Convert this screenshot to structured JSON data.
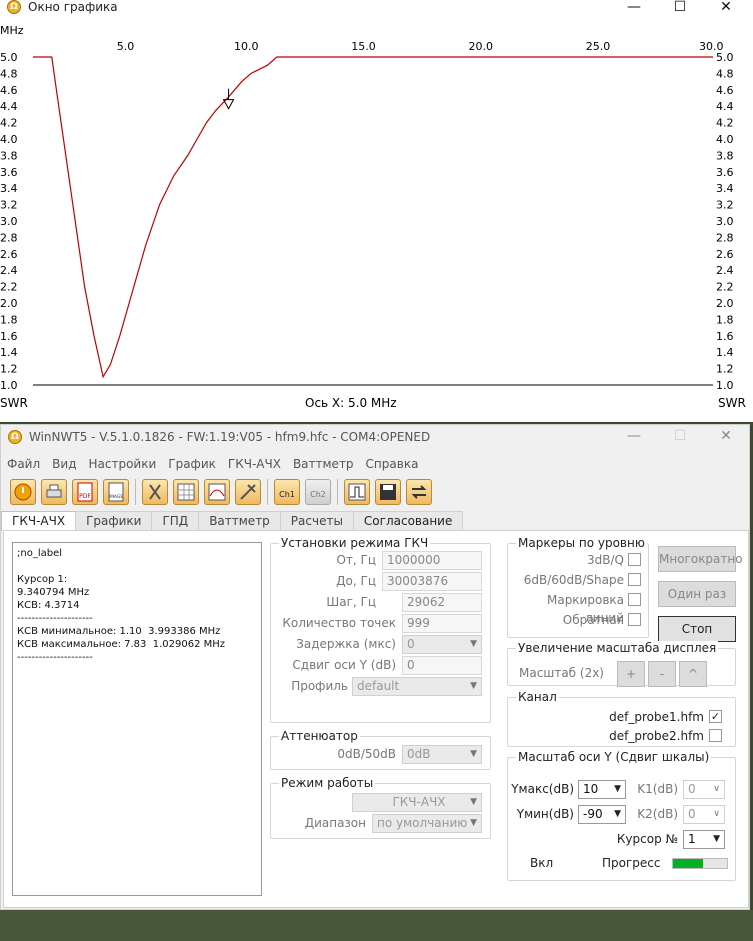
{
  "graph_window": {
    "title": "Окно графика",
    "chart_data": {
      "type": "line",
      "x_unit": "MHz",
      "y_unit_left": "SWR",
      "y_unit_right": "SWR",
      "x_ticks": [
        "5.0",
        "10.0",
        "15.0",
        "20.0",
        "25.0",
        "30.0"
      ],
      "y_ticks": [
        "5.0",
        "4.8",
        "4.6",
        "4.4",
        "4.2",
        "4.0",
        "3.8",
        "3.6",
        "3.4",
        "3.2",
        "3.0",
        "2.8",
        "2.6",
        "2.4",
        "2.2",
        "2.0",
        "1.8",
        "1.6",
        "1.4",
        "1.2",
        "1.0"
      ],
      "xlim": [
        1.0,
        30.0
      ],
      "ylim": [
        1.0,
        5.0
      ],
      "x_axis_caption": "Ось X: 5.0 MHz",
      "series_color": "#c00000",
      "x": [
        1.0,
        1.8,
        2.0,
        2.4,
        2.8,
        3.2,
        3.6,
        3.99,
        4.3,
        4.7,
        5.2,
        5.8,
        6.4,
        7.0,
        7.6,
        8.0,
        8.4,
        8.8,
        9.3,
        9.6,
        9.9,
        10.3,
        11.0,
        11.4,
        12.0,
        15.0,
        20.0,
        25.0,
        30.0
      ],
      "y": [
        5.0,
        5.0,
        4.6,
        3.8,
        3.0,
        2.2,
        1.6,
        1.1,
        1.25,
        1.6,
        2.1,
        2.7,
        3.2,
        3.55,
        3.8,
        4.0,
        4.2,
        4.35,
        4.5,
        4.6,
        4.7,
        4.8,
        4.9,
        5.0,
        5.0,
        5.0,
        5.0,
        5.0,
        5.0
      ],
      "marker": {
        "x": 9.34,
        "y": 4.37
      }
    }
  },
  "main_window": {
    "title": "WinNWT5 - V.5.1.0.1826 - FW:1.19:V05 - hfm9.hfc - COM4:OPENED",
    "menu": [
      "Файл",
      "Вид",
      "Настройки",
      "График",
      "ГКЧ-АЧХ",
      "Ваттметр",
      "Справка"
    ],
    "toolbar": {
      "pdf": "PDF",
      "image": "IMAGE",
      "ch1": "Ch1",
      "ch2": "Ch2"
    },
    "tabs": [
      "ГКЧ-АЧХ",
      "Графики",
      "ГПД",
      "Ваттметр",
      "Расчеты",
      "Согласование"
    ],
    "log_text": ";no_label\n\nКурсор 1:\n9.340794 MHz\nКСВ: 4.3714\n---------------------\nКСВ минимальное: 1.10  3.993386 MHz\nКСВ максимальное: 7.83  1.029062 MHz\n---------------------",
    "gen": {
      "title": "Установки режима ГКЧ",
      "from_label": "От, Гц",
      "from": "1000000",
      "to_label": "До, Гц",
      "to": "30003876",
      "step_label": "Шаг, Гц",
      "step": "29062",
      "points_label": "Количество точек",
      "points": "999",
      "delay_label": "Задержка (мкс)",
      "delay": "0",
      "yshift_label": "Сдвиг оси Y (dB)",
      "yshift": "0",
      "profile_label": "Профиль",
      "profile": "default"
    },
    "att": {
      "title": "Аттенюатор",
      "label": "0dB/50dB",
      "value": "0dB"
    },
    "mode": {
      "title": "Режим работы",
      "value": "ГКЧ-АЧХ",
      "range_label": "Диапазон",
      "range": "по умолчанию"
    },
    "markers": {
      "title": "Маркеры по уровню",
      "m1": "3dB/Q",
      "m2": "6dB/60dB/Shape",
      "m3": "Маркировка линий",
      "m4": "Обратная"
    },
    "buttons": {
      "repeat": "Многократно",
      "once": "Один раз",
      "stop": "Стоп"
    },
    "zoom": {
      "title": "Увеличение масштаба дисплея",
      "label": "Масштаб (2x)",
      "plus": "+",
      "minus": "-",
      "up": "^"
    },
    "channel": {
      "title": "Канал",
      "probe1": "def_probe1.hfm",
      "probe2": "def_probe2.hfm"
    },
    "yscale": {
      "title": "Масштаб оси Y (Сдвиг шкалы)",
      "ymax_label": "Yмакс(dB)",
      "ymax": "10",
      "ymin_label": "Yмин(dB)",
      "ymin": "-90",
      "k1_label": "K1(dB)",
      "k1": "0",
      "k2_label": "K2(dB)",
      "k2": "0",
      "cursor_label": "Курсор №",
      "cursor": "1",
      "on_label": "Вкл",
      "progress_label": "Прогресс",
      "progress": 0.55
    }
  }
}
